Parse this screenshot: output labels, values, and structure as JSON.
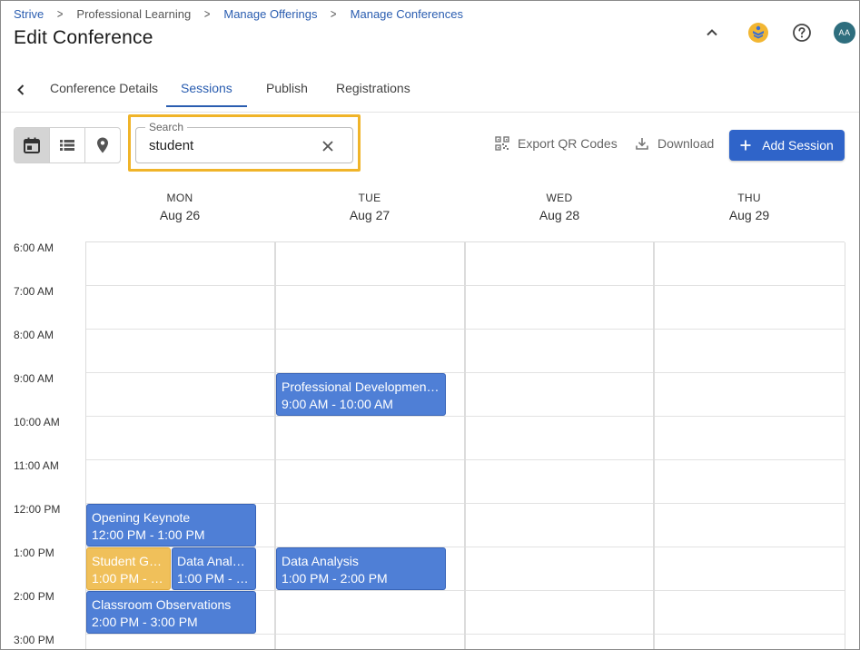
{
  "breadcrumb": [
    "Strive",
    "Professional Learning",
    "Manage Offerings",
    "Manage Conferences"
  ],
  "page_title": "Edit Conference",
  "user_initials": "AA",
  "tabs": [
    "Conference Details",
    "Sessions",
    "Publish",
    "Registrations"
  ],
  "active_tab": "Sessions",
  "search": {
    "label": "Search",
    "value": "student"
  },
  "actions": {
    "export_qr": "Export QR Codes",
    "download": "Download",
    "add_session": "Add Session"
  },
  "days": [
    {
      "name": "MON",
      "date": "Aug 26"
    },
    {
      "name": "TUE",
      "date": "Aug 27"
    },
    {
      "name": "WED",
      "date": "Aug 28"
    },
    {
      "name": "THU",
      "date": "Aug 29"
    }
  ],
  "times": [
    "6:00 AM",
    "7:00 AM",
    "8:00 AM",
    "9:00 AM",
    "10:00 AM",
    "11:00 AM",
    "12:00 PM",
    "1:00 PM",
    "2:00 PM",
    "3:00 PM"
  ],
  "events": [
    {
      "title": "Professional Developmen…",
      "time": "9:00 AM - 10:00 AM"
    },
    {
      "title": "Opening Keynote",
      "time": "12:00 PM - 1:00 PM"
    },
    {
      "title": "Student Gr…",
      "time": "1:00 PM - 2:…"
    },
    {
      "title": "Data Anal…",
      "time": "1:00 PM - 2:…"
    },
    {
      "title": "Data Analysis",
      "time": "1:00 PM - 2:00 PM"
    },
    {
      "title": "Classroom Observations",
      "time": "2:00 PM - 3:00 PM"
    }
  ],
  "colors": {
    "primary": "#2f64c9",
    "event": "#4f7fd6",
    "highlight_event": "#f0c05a",
    "search_highlight": "#f0b429"
  }
}
